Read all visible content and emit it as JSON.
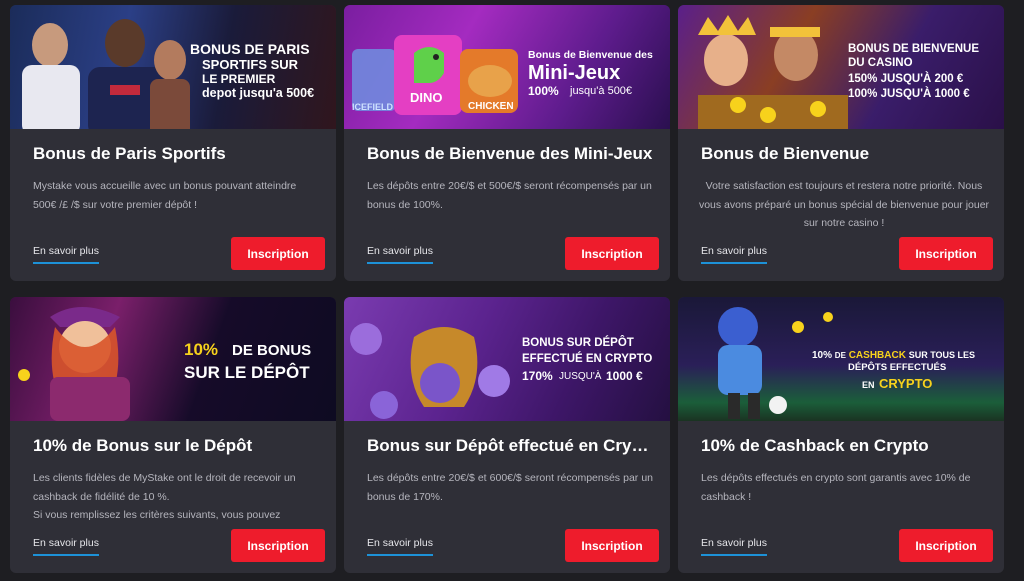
{
  "cards": [
    {
      "banner": {
        "line1": "BONUS DE PARIS",
        "line2": "SPORTIFS SUR",
        "line3": "LE PREMIER",
        "line4": "depot jusqu'a 500€"
      },
      "title": "Bonus de Paris Sportifs",
      "description": "Mystake vous accueille avec un bonus pouvant atteindre 500€ /£ /$ sur votre premier dépôt !",
      "more_label": "En savoir plus",
      "signup_label": "Inscription"
    },
    {
      "banner": {
        "line1": "Bonus de Bienvenue des",
        "line2": "Mini-Jeux",
        "line3": "100%",
        "line4": "jusqu'à 500€",
        "game1": "ICEFIELD",
        "game2": "DINO",
        "game3": "CHICKEN"
      },
      "title": "Bonus de Bienvenue des Mini-Jeux",
      "description": " Les dépôts entre 20€/$ et 500€/$ seront récompensés par un bonus de 100%.",
      "more_label": "En savoir plus",
      "signup_label": "Inscription"
    },
    {
      "banner": {
        "line1": "BONUS DE BIENVENUE",
        "line2": "DU CASINO",
        "line3": "150% JUSQU'À 200 €",
        "line4": "100% JUSQU'À 1000 €"
      },
      "title": "Bonus de Bienvenue",
      "description": "Votre satisfaction est toujours et restera notre priorité. Nous vous avons préparé un bonus spécial de bienvenue pour jouer sur notre casino !",
      "more_label": "En savoir plus",
      "signup_label": "Inscription"
    },
    {
      "banner": {
        "line1a": "10%",
        "line1b": "DE BONUS",
        "line2": "SUR LE DÉPÔT"
      },
      "title": "10% de Bonus sur le Dépôt",
      "description": "Les clients fidèles de MyStake ont le droit de recevoir un cashback de fidélité de 10 %.",
      "description2": "Si vous remplissez les critères suivants, vous pouvez",
      "more_label": "En savoir plus",
      "signup_label": "Inscription"
    },
    {
      "banner": {
        "line1": "BONUS SUR DÉPÔT",
        "line2": "EFFECTUÉ EN CRYPTO",
        "line3a": "170%",
        "line3b": "JUSQU'À",
        "line3c": "1000 €"
      },
      "title": "Bonus sur Dépôt effectué en Crypto",
      "description": "Les dépôts entre 20€/$ et 600€/$ seront récompensés par un bonus de 170%.",
      "more_label": "En savoir plus",
      "signup_label": "Inscription"
    },
    {
      "banner": {
        "line1a": "10%",
        "line1b": "DE",
        "line1c": "CASHBACK",
        "line1d": "SUR TOUS LES",
        "line2": "DÉPÔTS EFFECTUÉS",
        "line3a": "EN",
        "line3b": "CRYPTO"
      },
      "title": "10% de Cashback en Crypto",
      "description": "Les dépôts effectués en crypto sont garantis avec 10% de cashback !",
      "more_label": "En savoir plus",
      "signup_label": "Inscription"
    }
  ],
  "colors": {
    "page_bg": "#1e1e22",
    "card_bg": "#2f2f37",
    "signup_bg": "#ee1c2c",
    "link_underline": "#1d92d8",
    "highlight_yellow": "#f7d21c"
  }
}
